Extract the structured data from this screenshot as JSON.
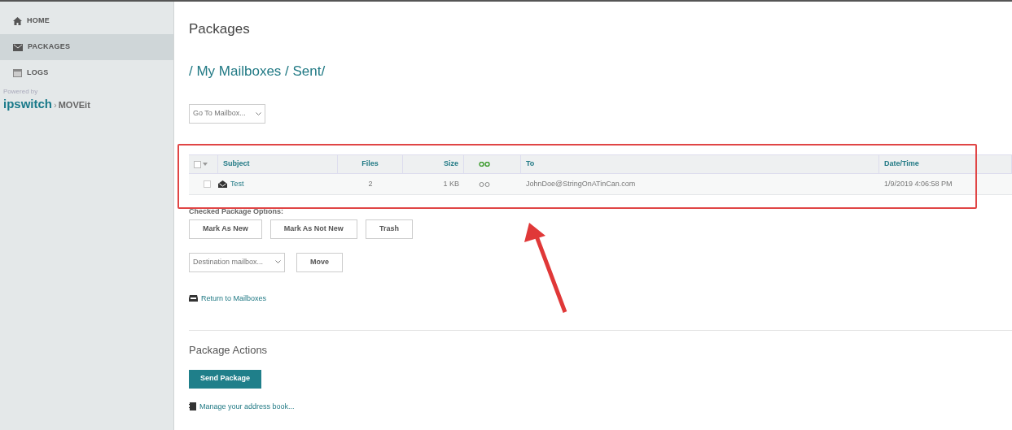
{
  "sidebar": {
    "items": [
      {
        "label": "HOME",
        "selected": false
      },
      {
        "label": "PACKAGES",
        "selected": true
      },
      {
        "label": "LOGS",
        "selected": false
      }
    ],
    "powered_by": "Powered by",
    "brand": "ipswitch",
    "brand_separator": "›",
    "product": "MOVEit"
  },
  "page_title": "Packages",
  "breadcrumb": "/ My Mailboxes / Sent/",
  "mailbox_select": {
    "value": "Go To Mailbox..."
  },
  "table": {
    "all_checked": false,
    "columns": [
      {
        "kind": "select"
      },
      {
        "kind": "text",
        "label": "Subject"
      },
      {
        "kind": "text",
        "label": "Files"
      },
      {
        "kind": "text",
        "label": "Size"
      },
      {
        "kind": "read"
      },
      {
        "kind": "text",
        "label": "To"
      },
      {
        "kind": "text",
        "label": "Date/Time"
      }
    ],
    "rows": [
      {
        "checked": false,
        "subject": "Test",
        "files": "2",
        "size": "1 KB",
        "to": "JohnDoe@StringOnATinCan.com",
        "date_time": "1/9/2019 4:06:58 PM"
      }
    ]
  },
  "checked_options": {
    "label": "Checked Package Options:",
    "buttons": [
      "Mark As New",
      "Mark As Not New",
      "Trash"
    ],
    "destination_select": {
      "value": "Destination mailbox..."
    },
    "move_button": "Move"
  },
  "return_link": "Return to Mailboxes",
  "package_actions": {
    "title": "Package Actions",
    "send_button": "Send Package",
    "address_book_link": "Manage your address book..."
  }
}
